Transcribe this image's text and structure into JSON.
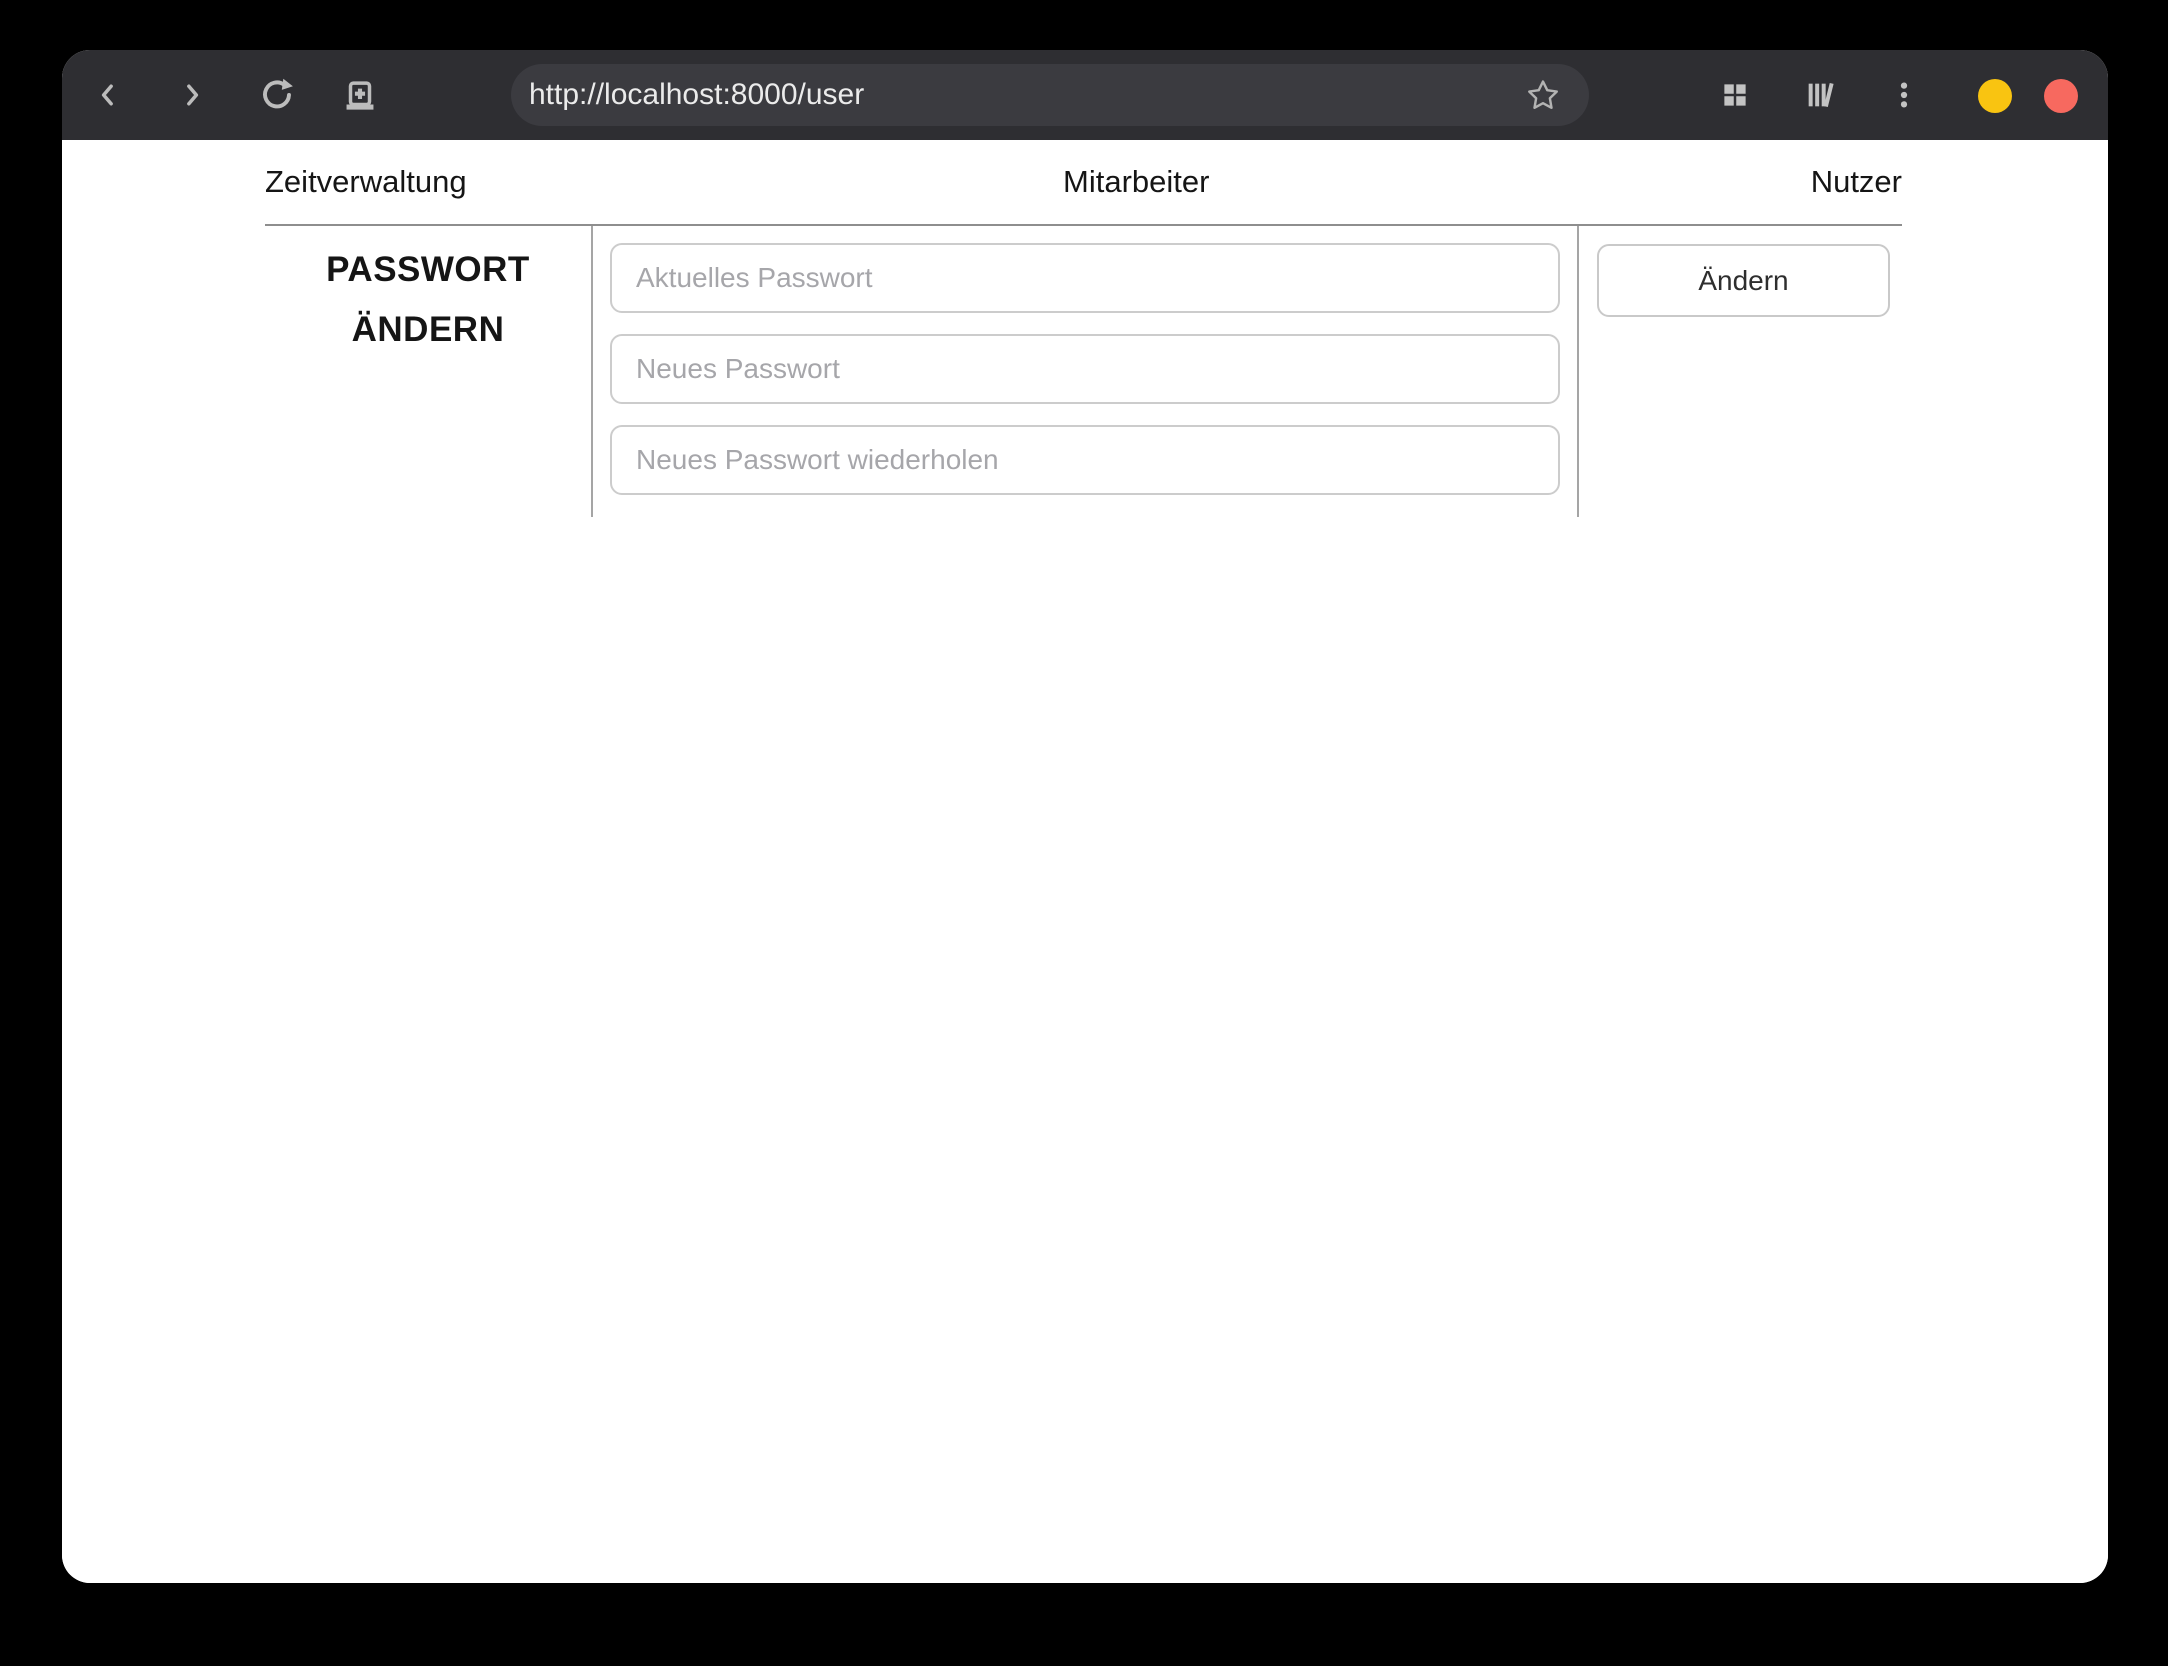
{
  "browser": {
    "url": "http://localhost:8000/user",
    "controls": {
      "minimize_color": "#f9c411",
      "close_color": "#f7695f"
    },
    "icons": {
      "back": "chevron-left",
      "forward": "chevron-right",
      "reload": "refresh-arrow",
      "new_tab": "tab-plus",
      "bookmark": "star-outline",
      "apps": "grid-2x2",
      "library": "book-shelf",
      "menu": "vertical-kebab"
    }
  },
  "nav": {
    "items": [
      "Zeitverwaltung",
      "Mitarbeiter",
      "Nutzer"
    ]
  },
  "main": {
    "heading_lines": [
      "PASSWORT",
      "ÄNDERN"
    ],
    "fields": [
      {
        "placeholder": "Aktuelles Passwort",
        "value": ""
      },
      {
        "placeholder": "Neues Passwort",
        "value": ""
      },
      {
        "placeholder": "Neues Passwort wiederholen",
        "value": ""
      }
    ],
    "submit_label": "Ändern"
  }
}
